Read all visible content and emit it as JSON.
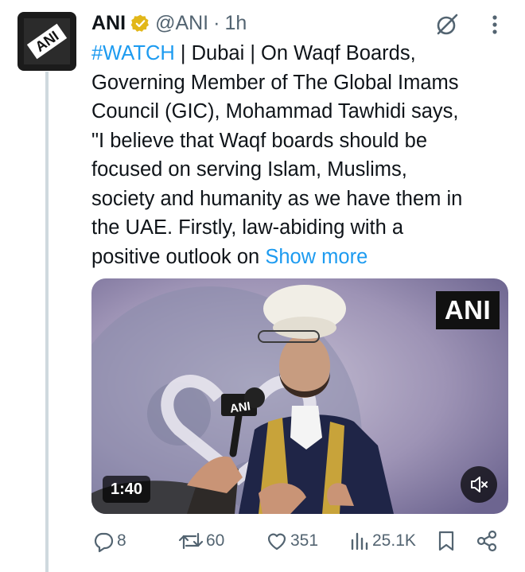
{
  "tweet": {
    "author_name": "ANI",
    "handle": "@ANI",
    "separator": "·",
    "time": "1h",
    "avatar_logo_text": "ANI",
    "hashtag": "#WATCH",
    "body": " | Dubai | On Waqf Boards,\nGoverning Member of The Global Imams\nCouncil (GIC), Mohammad Tawhidi says,\n\"I believe that Waqf boards should be\nfocused on serving Islam, Muslims,\nsociety and humanity as we have them in\nthe UAE. Firstly, law-abiding with a\npositive outlook on ",
    "show_more": "Show more"
  },
  "media": {
    "watermark": "ANI",
    "mic_logo": "ANI",
    "duration": "1:40"
  },
  "actions": {
    "replies": "8",
    "reposts": "60",
    "likes": "351",
    "views": "25.1K"
  },
  "icons": {
    "verified": "verified-badge-icon",
    "grok": "grok-icon",
    "more": "more-vertical-icon",
    "reply": "reply-icon",
    "repost": "repost-icon",
    "like": "heart-icon",
    "views": "views-icon",
    "bookmark": "bookmark-icon",
    "share": "share-icon",
    "mute": "mute-icon"
  },
  "colors": {
    "link": "#1d9bf0",
    "muted": "#536471",
    "text": "#0f1419",
    "verified_gold": "#e2b719"
  }
}
